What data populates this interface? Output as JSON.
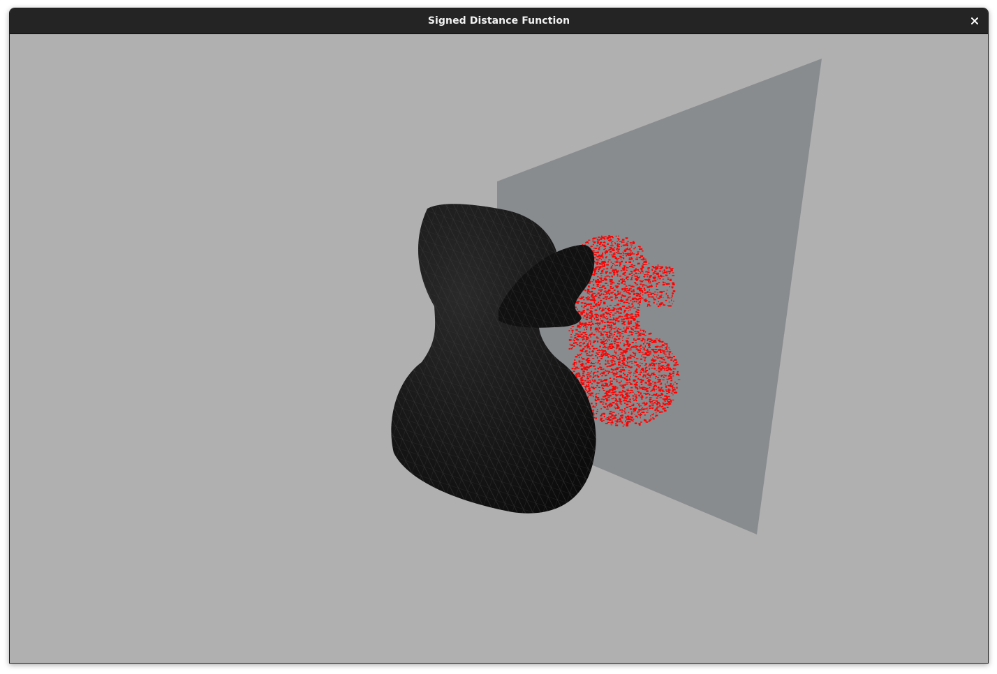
{
  "window": {
    "title": "Signed Distance Function",
    "close_icon": "close-icon"
  },
  "scene": {
    "background_color": "#b0b0b0",
    "plane_color": "#898c8e",
    "mesh_color": "#141414",
    "points_color": "#ff0000",
    "mesh_name": "duck",
    "mesh_style": "wireframe-shaded"
  }
}
